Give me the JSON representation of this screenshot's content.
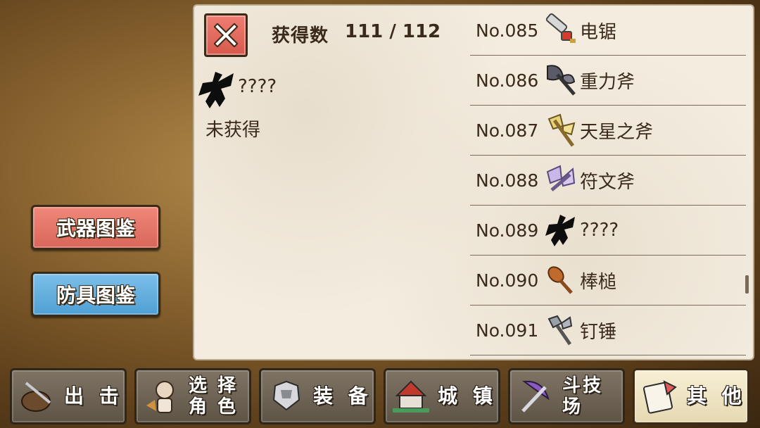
{
  "categories": {
    "weapon_label": "武器图鉴",
    "armor_label": "防具图鉴"
  },
  "panel": {
    "count_label": "获得数",
    "count_value": "111 / 112",
    "detail": {
      "name": "????",
      "status": "未获得",
      "icon": "silhouette-axe-icon"
    }
  },
  "list": [
    {
      "num": "No.085",
      "name": "电锯",
      "icon": "chainsaw-icon"
    },
    {
      "num": "No.086",
      "name": "重力斧",
      "icon": "gravity-axe-icon"
    },
    {
      "num": "No.087",
      "name": "天星之斧",
      "icon": "star-axe-icon"
    },
    {
      "num": "No.088",
      "name": "符文斧",
      "icon": "rune-axe-icon"
    },
    {
      "num": "No.089",
      "name": "????",
      "icon": "silhouette-axe-icon"
    },
    {
      "num": "No.090",
      "name": "棒槌",
      "icon": "club-icon"
    },
    {
      "num": "No.091",
      "name": "钉锤",
      "icon": "spiked-hammer-icon"
    }
  ],
  "nav": [
    {
      "label": "出 击",
      "icon": "sortie-icon"
    },
    {
      "label": "选 择\n角 色",
      "icon": "character-icon"
    },
    {
      "label": "装 备",
      "icon": "armor-icon"
    },
    {
      "label": "城 镇",
      "icon": "town-icon"
    },
    {
      "label": "斗技场",
      "icon": "arena-icon"
    },
    {
      "label": "其 他",
      "icon": "other-icon"
    }
  ],
  "colors": {
    "weapon_button": "#e07266",
    "armor_button": "#5aa7d9",
    "close_button": "#e26b5f",
    "parchment": "#f3ecdf"
  }
}
